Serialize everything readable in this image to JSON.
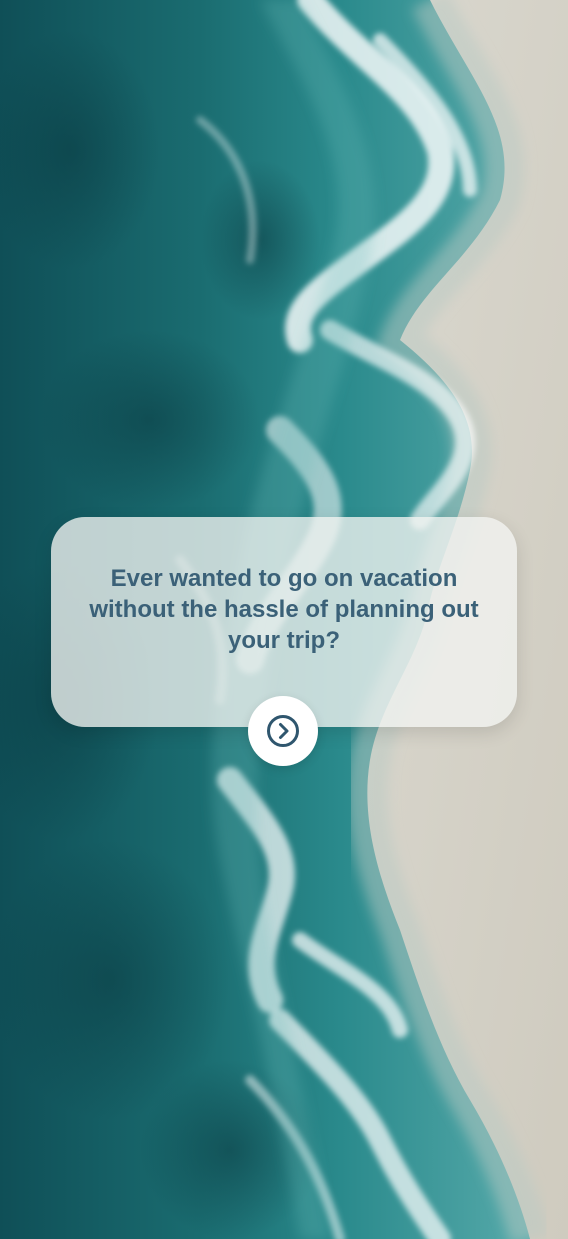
{
  "onboarding": {
    "message": "Ever wanted to go on vacation without the hassle of planning out your trip?",
    "next_icon": "chevron-right-circle-icon"
  },
  "colors": {
    "ocean_deep": "#0f4f57",
    "ocean_mid": "#1f7d80",
    "sand": "#d9d6cc",
    "text": "#3b6178",
    "card_bg": "#f2f4f1"
  }
}
